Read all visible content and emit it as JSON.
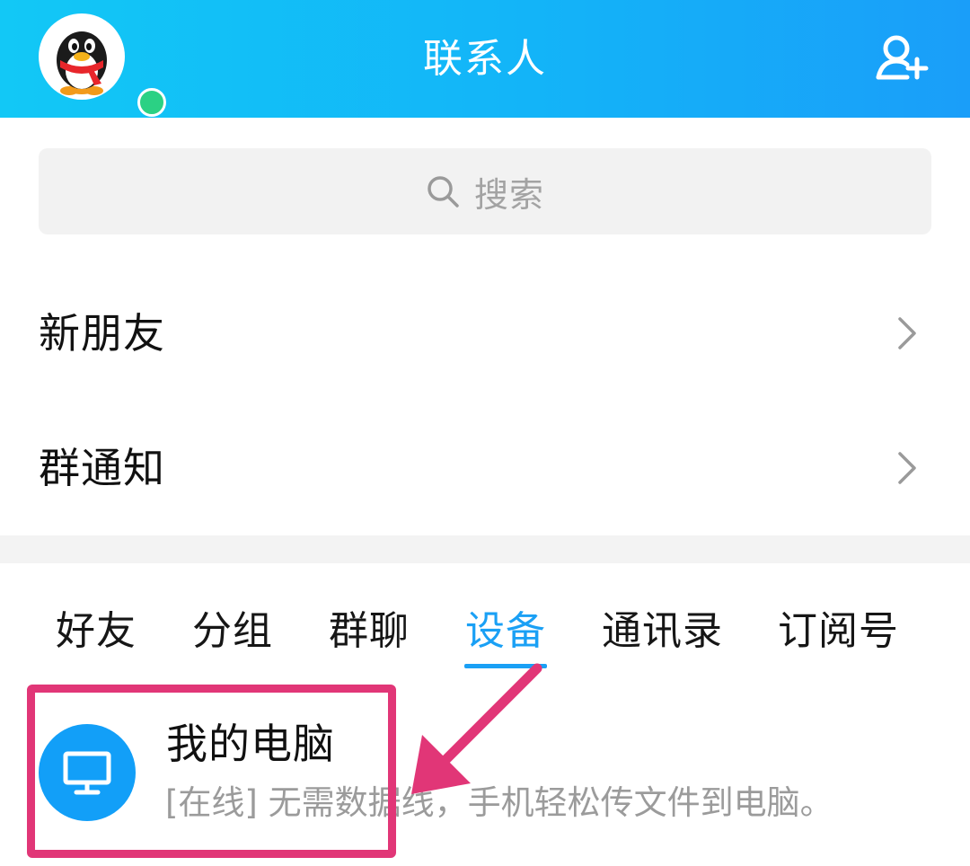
{
  "header": {
    "title": "联系人",
    "avatar": "qq-penguin-avatar",
    "status": "online",
    "add_icon": "add-contact-icon"
  },
  "search": {
    "placeholder": "搜索",
    "icon": "search-icon"
  },
  "list": [
    {
      "label": "新朋友",
      "icon": "chevron-right-icon"
    },
    {
      "label": "群通知",
      "icon": "chevron-right-icon"
    }
  ],
  "tabs": [
    {
      "label": "好友",
      "active": false
    },
    {
      "label": "分组",
      "active": false
    },
    {
      "label": "群聊",
      "active": false
    },
    {
      "label": "设备",
      "active": true
    },
    {
      "label": "通讯录",
      "active": false
    },
    {
      "label": "订阅号",
      "active": false
    }
  ],
  "device": {
    "name": "我的电脑",
    "status": "[在线] 无需数据线，手机轻松传文件到电脑。",
    "icon": "monitor-icon"
  },
  "colors": {
    "header_start": "#12c8f6",
    "header_end": "#1a9ef9",
    "accent": "#1aa0f5",
    "annotation": "#e13677"
  }
}
